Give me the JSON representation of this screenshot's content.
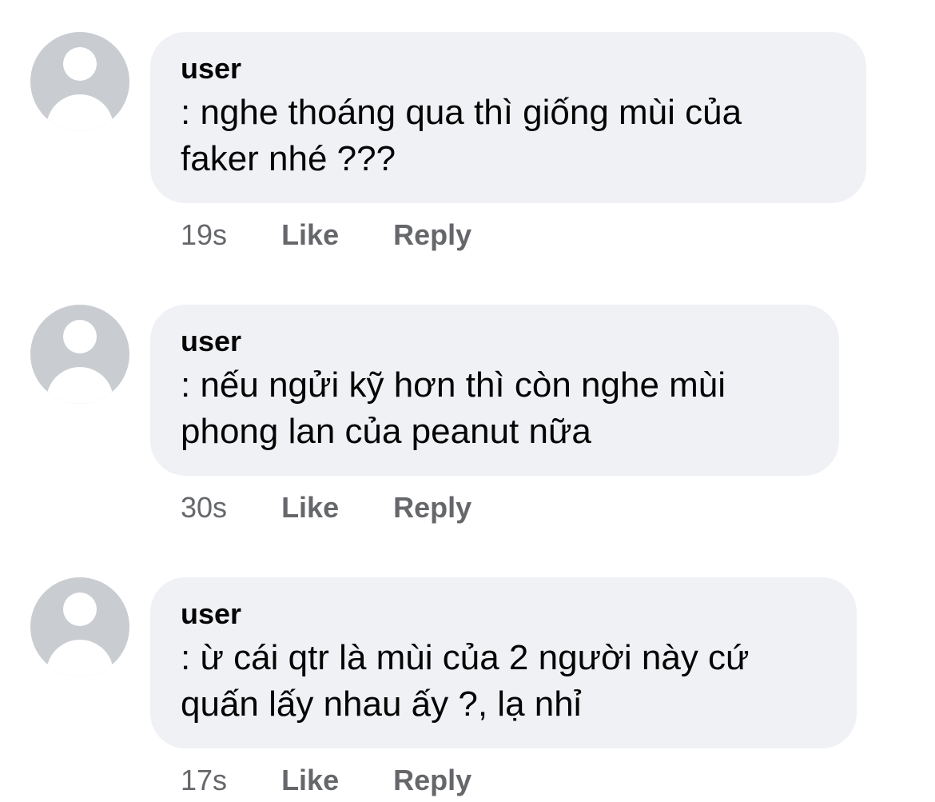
{
  "comments": [
    {
      "author": "user",
      "text": ": nghe thoáng qua thì giống mùi của\nfaker nhé ???",
      "time": "19s",
      "like_label": "Like",
      "reply_label": "Reply"
    },
    {
      "author": "user",
      "text": ": nếu ngửi kỹ hơn thì còn nghe mùi\nphong lan của peanut nữa",
      "time": "30s",
      "like_label": "Like",
      "reply_label": "Reply"
    },
    {
      "author": "user",
      "text": ": ừ cái qtr là mùi của 2 người này cứ\nquấn lấy nhau ấy ?, lạ nhỉ",
      "time": "17s",
      "like_label": "Like",
      "reply_label": "Reply"
    }
  ],
  "colors": {
    "bubble_background": "#f0f1f5",
    "avatar_placeholder": "#c9ccd1",
    "meta_text": "#65676b",
    "primary_text": "#050505"
  },
  "icons": {
    "avatar": "default-user-silhouette-icon"
  }
}
